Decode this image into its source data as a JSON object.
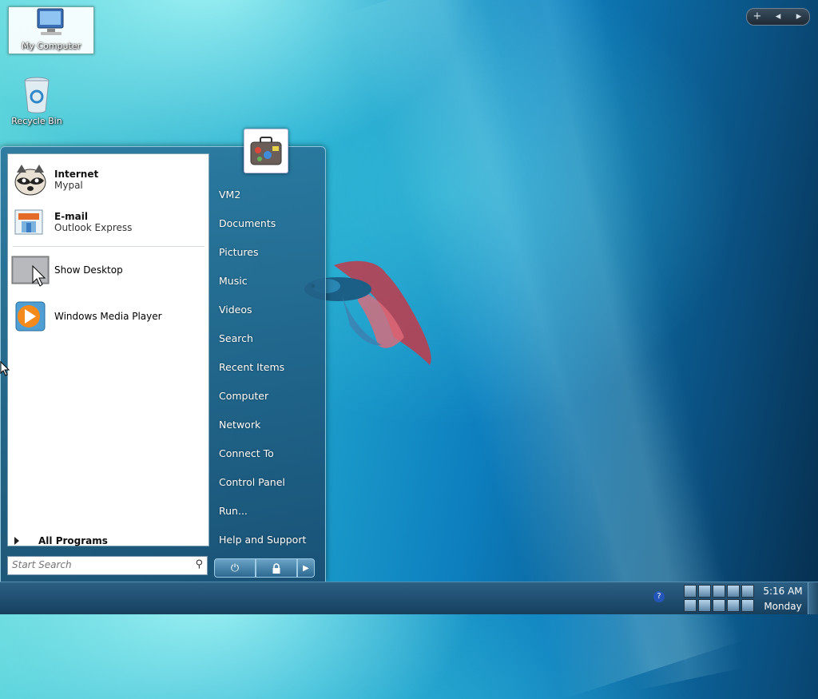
{
  "desktop": {
    "icons": [
      {
        "label": "My Computer"
      },
      {
        "label": "Recycle Bin"
      }
    ]
  },
  "gadget_bar": {
    "add": "+",
    "prev": "◂",
    "next": "▸"
  },
  "start_menu": {
    "pinned": [
      {
        "title": "Internet",
        "subtitle": "Mypal"
      },
      {
        "title": "E-mail",
        "subtitle": "Outlook Express"
      }
    ],
    "recent": [
      {
        "title": "Show Desktop"
      },
      {
        "title": "Windows Media Player"
      }
    ],
    "all_programs": "All Programs",
    "search": {
      "placeholder": "Start Search"
    },
    "right_items": [
      "VM2",
      "Documents",
      "Pictures",
      "Music",
      "Videos",
      "Search",
      "Recent Items",
      "Computer",
      "Network",
      "Connect To",
      "Control Panel",
      "Run...",
      "Help and Support"
    ]
  },
  "taskbar": {
    "help": "?",
    "clock": {
      "time": "5:16 AM",
      "day": "Monday"
    }
  },
  "icons": {
    "start_menu_user": "suitcase-icon",
    "power": "power-icon",
    "lock": "lock-icon",
    "arrow": "chevron-right-icon"
  }
}
